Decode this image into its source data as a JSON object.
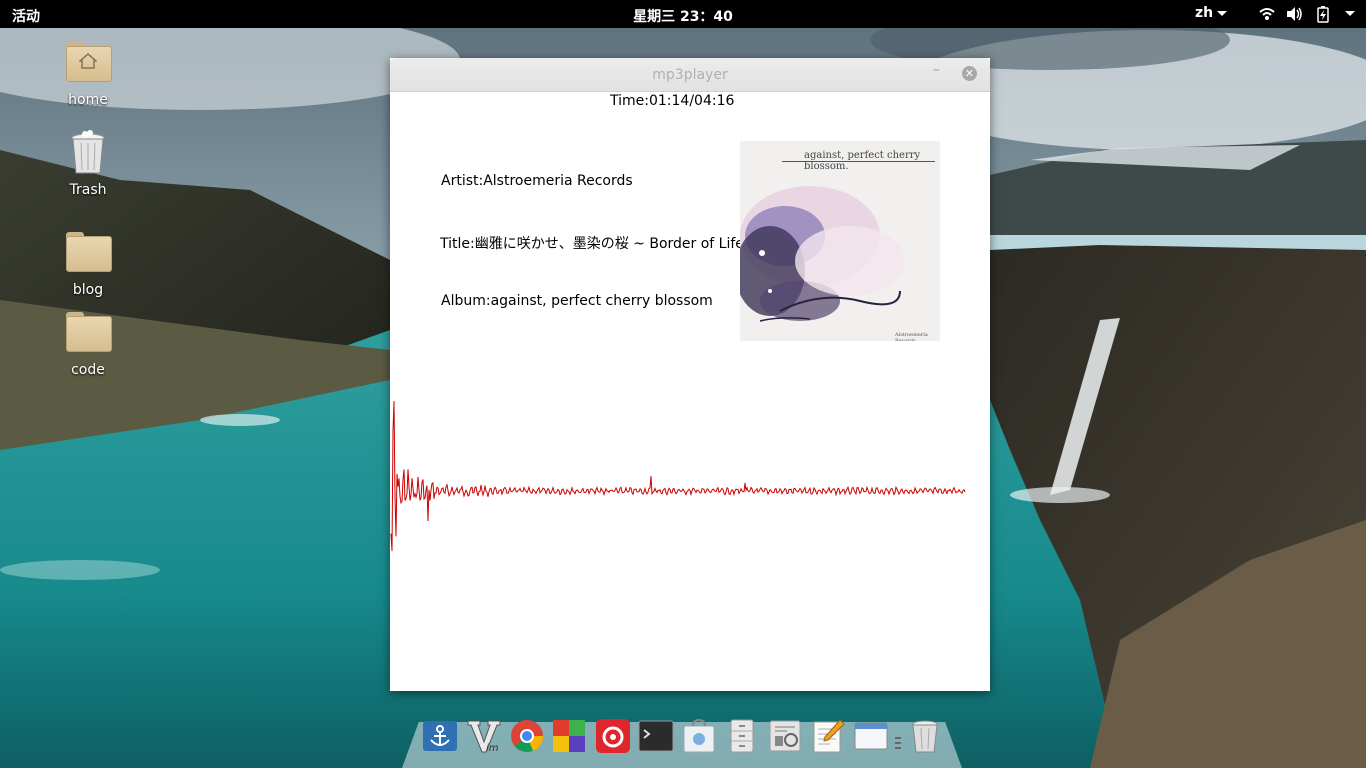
{
  "topbar": {
    "activities": "活动",
    "clock": "星期三 23：40",
    "language": "zh",
    "tray_icons": [
      "wifi-icon",
      "volume-icon",
      "battery-icon"
    ]
  },
  "desktop": {
    "icons": [
      {
        "label": "home",
        "icon": "home-folder-icon"
      },
      {
        "label": "Trash",
        "icon": "trash-icon"
      },
      {
        "label": "blog",
        "icon": "folder-icon"
      },
      {
        "label": "code",
        "icon": "folder-icon"
      }
    ]
  },
  "window": {
    "title": "mp3player",
    "minimize_symbol": "–",
    "close_symbol": "✕",
    "time": "Time:01:14/04:16",
    "artist": "Artist:Alstroemeria Records",
    "song_title": "Title:幽雅に咲かせ、墨染の桜 ~ Border of Life",
    "album": "Album:against, perfect cherry blossom",
    "cover": {
      "caption": "against, perfect cherry blossom.",
      "footer": "Alstroemeria Records"
    },
    "waveform_color": "#cc0000"
  },
  "dock": {
    "apps": [
      "anchor-app-icon",
      "vim-icon",
      "chrome-icon",
      "colorful-app-icon",
      "netease-music-icon",
      "terminal-icon",
      "software-center-icon",
      "file-cabinet-icon",
      "settings-icon",
      "text-editor-icon",
      "window-icon",
      "trash-icon"
    ]
  }
}
